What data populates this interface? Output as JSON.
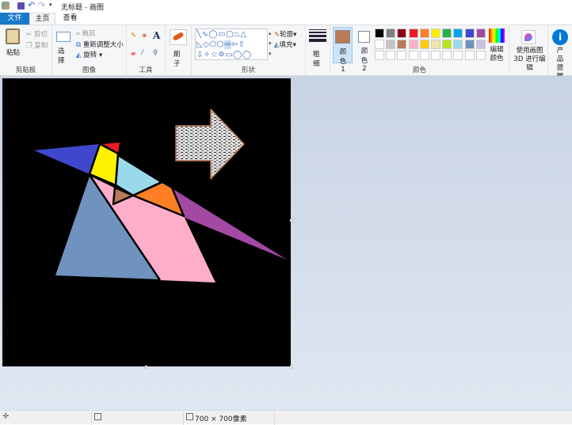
{
  "title": "无标题 - 画图",
  "tabs": [
    "文件",
    "主页",
    "查看"
  ],
  "clipboard": {
    "paste": "粘贴",
    "cut": "剪切",
    "copy": "复制",
    "label": "剪贴板"
  },
  "image": {
    "select": "选择",
    "crop": "裁剪",
    "resize": "重新调整大小",
    "rotate": "旋转",
    "label": "图像"
  },
  "tools": {
    "label": "工具"
  },
  "brush": {
    "label": "刷子"
  },
  "shapes": {
    "outline": "轮廓",
    "fill": "填充",
    "label": "形状"
  },
  "size": {
    "label": "粗细"
  },
  "colors": {
    "color1": "颜色 1",
    "color2": "颜色 2",
    "edit": "编辑颜色",
    "label": "颜色",
    "color1_value": "#b97a57",
    "color2_value": "#ffffff",
    "palette": [
      "#000000",
      "#7f7f7f",
      "#880015",
      "#ed1c24",
      "#ff7f27",
      "#fff200",
      "#22b14c",
      "#00a2e8",
      "#3f48cc",
      "#a349a4",
      "#ffffff",
      "#c3c3c3",
      "#b97a57",
      "#ffaec9",
      "#ffc90e",
      "#efe4b0",
      "#b5e61d",
      "#99d9ea",
      "#7092be",
      "#c8bfe7"
    ]
  },
  "paint3d": "使用画图 3D 进行编辑",
  "product": "产品提醒",
  "status": {
    "size": "700 × 700像素"
  },
  "drawing": {
    "colors": {
      "blue": "#3f48cc",
      "red": "#ed1c24",
      "yellow": "#fff200",
      "light_blue": "#99d9ea",
      "brown": "#b97a57",
      "orange": "#ff7f27",
      "purple": "#a349a4",
      "steel_blue": "#7092be",
      "pink": "#ffaec9"
    }
  }
}
